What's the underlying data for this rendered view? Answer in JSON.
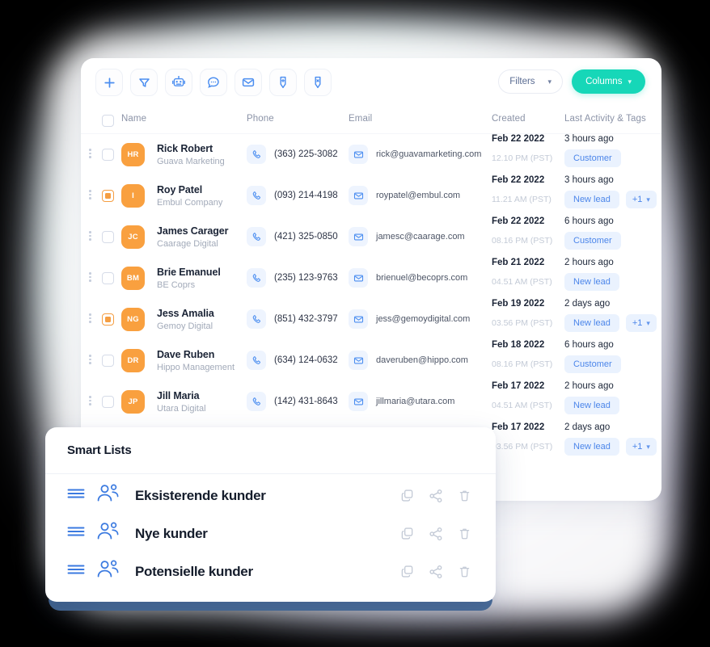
{
  "theme": {
    "accent_teal": "#16d7b8",
    "accent_orange": "#f9a03f",
    "accent_blue": "#4c86ea",
    "tag_bg": "#eaf2fe",
    "background": "#000000"
  },
  "toolbar": {
    "icons": [
      {
        "name": "add-icon",
        "label": "Add"
      },
      {
        "name": "filter-funnel-icon",
        "label": "Filter"
      },
      {
        "name": "robot-automation-icon",
        "label": "Automation"
      },
      {
        "name": "chat-bubble-icon",
        "label": "Chat"
      },
      {
        "name": "envelope-mail-icon",
        "label": "Email"
      },
      {
        "name": "tag-add-icon",
        "label": "Add tag"
      },
      {
        "name": "tag-remove-icon",
        "label": "Remove tag"
      }
    ],
    "filters_label": "Filters",
    "columns_label": "Columns"
  },
  "table": {
    "headers": {
      "name": "Name",
      "phone": "Phone",
      "email": "Email",
      "created": "Created",
      "activity": "Last Activity & Tags"
    },
    "rows": [
      {
        "selected": false,
        "initials": "HR",
        "name": "Rick Robert",
        "company": "Guava Marketing",
        "phone": "(363) 225-3082",
        "email": "rick@guavamarketing.com"
      },
      {
        "selected": true,
        "initials": "I",
        "name": "Roy Patel",
        "company": "Embul Company",
        "phone": "(093) 214-4198",
        "email": "roypatel@embul.com"
      },
      {
        "selected": false,
        "initials": "JC",
        "name": "James Carager",
        "company": "Caarage Digital",
        "phone": "(421) 325-0850",
        "email": "jamesc@caarage.com"
      },
      {
        "selected": false,
        "initials": "BM",
        "name": "Brie Emanuel",
        "company": "BE Coprs",
        "phone": "(235) 123-9763",
        "email": "brienuel@becoprs.com"
      },
      {
        "selected": true,
        "initials": "NG",
        "name": "Jess Amalia",
        "company": "Gemoy Digital",
        "phone": "(851) 432-3797",
        "email": "jess@gemoydigital.com"
      },
      {
        "selected": false,
        "initials": "DR",
        "name": "Dave Ruben",
        "company": "Hippo Management",
        "phone": "(634) 124-0632",
        "email": "daveruben@hippo.com"
      },
      {
        "selected": false,
        "initials": "JP",
        "name": "Jill Maria",
        "company": "Utara Digital",
        "phone": "(142) 431-8643",
        "email": "jillmaria@utara.com"
      }
    ],
    "created": [
      {
        "date": "Feb 22 2022",
        "time": "12.10 PM (PST)"
      },
      {
        "date": "Feb 22 2022",
        "time": "11.21 AM (PST)"
      },
      {
        "date": "Feb 22 2022",
        "time": "08.16 PM (PST)"
      },
      {
        "date": "Feb 21 2022",
        "time": "04.51 AM (PST)"
      },
      {
        "date": "Feb 19 2022",
        "time": "03.56 PM (PST)"
      },
      {
        "date": "Feb 18 2022",
        "time": "08.16 PM (PST)"
      },
      {
        "date": "Feb 17 2022",
        "time": "04.51 AM (PST)"
      },
      {
        "date": "Feb 17 2022",
        "time": "03.56 PM (PST)"
      }
    ],
    "activity": [
      {
        "when": "3 hours ago",
        "tag": "Customer",
        "more": ""
      },
      {
        "when": "3 hours ago",
        "tag": "New lead",
        "more": "+1"
      },
      {
        "when": "6 hours ago",
        "tag": "Customer",
        "more": ""
      },
      {
        "when": "2 hours ago",
        "tag": "New lead",
        "more": ""
      },
      {
        "when": "2 days ago",
        "tag": "New lead",
        "more": "+1"
      },
      {
        "when": "6 hours ago",
        "tag": "Customer",
        "more": ""
      },
      {
        "when": "2 hours ago",
        "tag": "New lead",
        "more": ""
      },
      {
        "when": "2 days ago",
        "tag": "New lead",
        "more": "+1"
      }
    ]
  },
  "smart_lists": {
    "title": "Smart Lists",
    "items": [
      {
        "label": "Eksisterende kunder"
      },
      {
        "label": "Nye kunder"
      },
      {
        "label": "Potensielle kunder"
      }
    ],
    "row_actions": [
      {
        "name": "duplicate-icon"
      },
      {
        "name": "share-icon"
      },
      {
        "name": "trash-icon"
      }
    ]
  }
}
